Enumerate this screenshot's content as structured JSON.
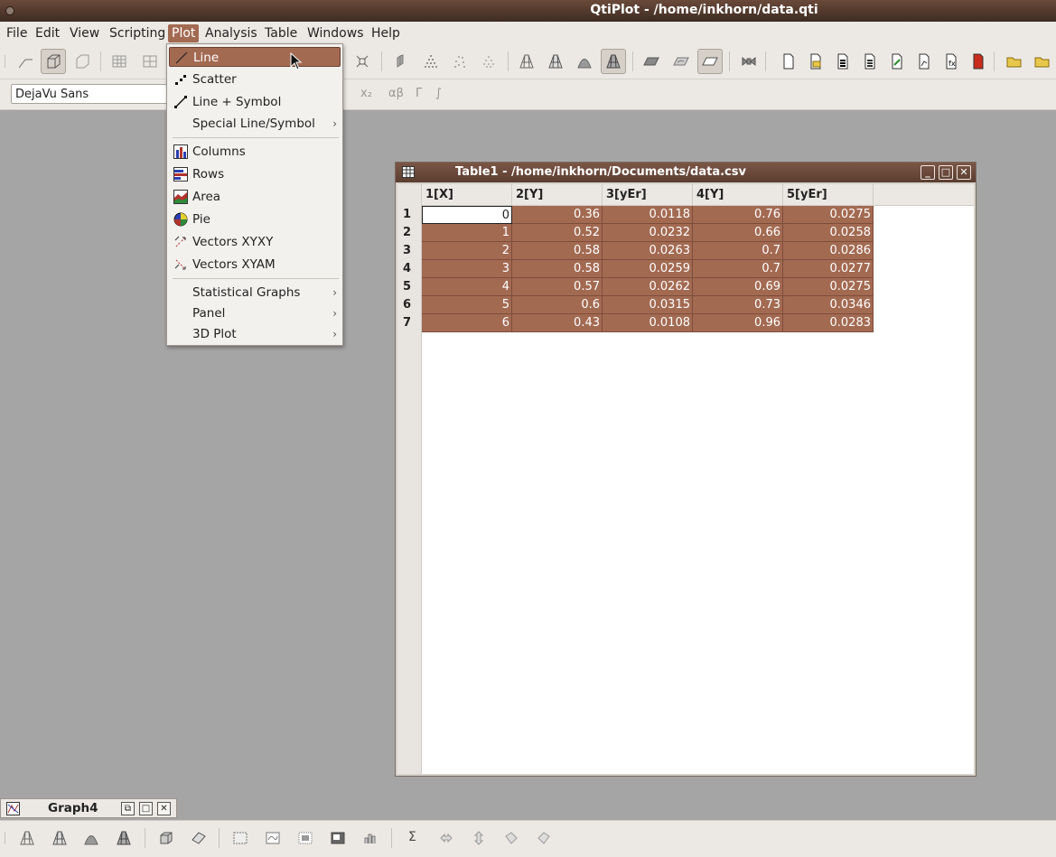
{
  "window": {
    "title": "QtiPlot - /home/inkhorn/data.qti"
  },
  "menubar": {
    "items": [
      "File",
      "Edit",
      "View",
      "Scripting",
      "Plot",
      "Analysis",
      "Table",
      "Windows",
      "Help"
    ],
    "active": "Plot"
  },
  "format_toolbar": {
    "font_family_value": "DejaVu Sans",
    "subscript_label": "x₂",
    "greek_label": "αβ",
    "greek_upper_label": "Γ",
    "integral_label": "∫"
  },
  "plot_menu": {
    "items": [
      {
        "label": "Line",
        "icon": "line-plot-icon",
        "highlighted": true
      },
      {
        "label": "Scatter",
        "icon": "scatter-plot-icon"
      },
      {
        "label": "Line + Symbol",
        "icon": "line-symbol-plot-icon"
      },
      {
        "label": "Special Line/Symbol",
        "submenu": true
      },
      {
        "label": "Columns",
        "icon": "columns-plot-icon"
      },
      {
        "label": "Rows",
        "icon": "rows-plot-icon"
      },
      {
        "label": "Area",
        "icon": "area-plot-icon"
      },
      {
        "label": "Pie",
        "icon": "pie-plot-icon"
      },
      {
        "label": "Vectors XYXY",
        "icon": "vectors-xyxy-icon"
      },
      {
        "label": "Vectors XYAM",
        "icon": "vectors-xyam-icon"
      },
      {
        "label": "Statistical Graphs",
        "submenu": true
      },
      {
        "label": "Panel",
        "submenu": true
      },
      {
        "label": "3D Plot",
        "submenu": true
      }
    ],
    "submenu_arrow": "›"
  },
  "table_window": {
    "title": "Table1 - /home/inkhorn/Documents/data.csv",
    "columns": [
      "1[X]",
      "2[Y]",
      "3[yEr]",
      "4[Y]",
      "5[yEr]"
    ],
    "rows": [
      {
        "num": "1",
        "cells": [
          "0",
          "0.36",
          "0.0118",
          "0.76",
          "0.0275"
        ]
      },
      {
        "num": "2",
        "cells": [
          "1",
          "0.52",
          "0.0232",
          "0.66",
          "0.0258"
        ]
      },
      {
        "num": "3",
        "cells": [
          "2",
          "0.58",
          "0.0263",
          "0.7",
          "0.0286"
        ]
      },
      {
        "num": "4",
        "cells": [
          "3",
          "0.58",
          "0.0259",
          "0.7",
          "0.0277"
        ]
      },
      {
        "num": "5",
        "cells": [
          "4",
          "0.57",
          "0.0262",
          "0.69",
          "0.0275"
        ]
      },
      {
        "num": "6",
        "cells": [
          "5",
          "0.6",
          "0.0315",
          "0.73",
          "0.0346"
        ]
      },
      {
        "num": "7",
        "cells": [
          "6",
          "0.43",
          "0.0108",
          "0.96",
          "0.0283"
        ]
      }
    ],
    "selection_color": "#a36a52"
  },
  "graph_window": {
    "title": "Graph4"
  },
  "bottom_toolbar": {
    "sum_label": "Σ"
  },
  "colors": {
    "accent": "#a36a52",
    "title_bar": "#4a3428",
    "workspace": "#a5a5a5"
  }
}
